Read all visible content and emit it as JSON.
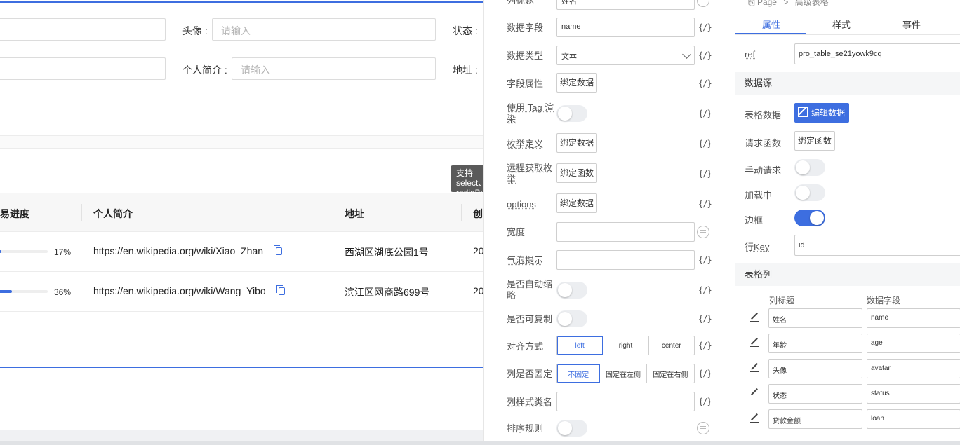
{
  "canvas": {
    "form": {
      "row1": {
        "avatar_label": "头像 :",
        "avatar_placeholder": "请输入",
        "status_label": "状态 :"
      },
      "row2": {
        "intro_label": "个人简介 :",
        "intro_placeholder": "请输入",
        "address_label": "地址 :"
      }
    },
    "tooltip_text": "支持select、radioButton",
    "table": {
      "headers": [
        "易进度",
        "个人简介",
        "地址",
        "创"
      ],
      "rows": [
        {
          "progress": 0.17,
          "progress_label": "17%",
          "intro": "https://en.wikipedia.org/wiki/Xiao_Zhan",
          "address": "西湖区湖底公园1号",
          "created": "20"
        },
        {
          "progress": 0.36,
          "progress_label": "36%",
          "intro": "https://en.wikipedia.org/wiki/Wang_Yibo",
          "address": "滨江区网商路699号",
          "created": "20"
        }
      ]
    }
  },
  "middle": {
    "title_row": {
      "label": "列标题",
      "value": "姓名"
    },
    "field": {
      "label": "数据字段",
      "value": "name"
    },
    "data_type": {
      "label": "数据类型",
      "value": "文本"
    },
    "field_props": {
      "label": "字段属性",
      "button": "绑定数据"
    },
    "use_tag": {
      "label": "使用 Tag 渲染"
    },
    "enum_def": {
      "label": "枚举定义",
      "button": "绑定数据"
    },
    "remote_enum": {
      "label": "远程获取枚举",
      "button": "绑定函数"
    },
    "options": {
      "label": "options",
      "button": "绑定数据"
    },
    "width": {
      "label": "宽度"
    },
    "tooltip": {
      "label": "气泡提示"
    },
    "ellipsis": {
      "label": "是否自动缩略"
    },
    "copyable": {
      "label": "是否可复制"
    },
    "align": {
      "label": "对齐方式",
      "options": [
        "left",
        "right",
        "center"
      ],
      "selected": "left"
    },
    "fixed": {
      "label": "列是否固定",
      "options": [
        "不固定",
        "固定在左侧",
        "固定在右侧"
      ],
      "selected": "不固定"
    },
    "class_name": {
      "label": "列样式类名"
    },
    "sort_rule": {
      "label": "排序规则"
    },
    "brace_icon": "{/}"
  },
  "right": {
    "breadcrumb": {
      "page": "Page",
      "sep": ">",
      "current": "高级表格"
    },
    "tabs": [
      {
        "label": "属性",
        "active": true
      },
      {
        "label": "样式",
        "active": false
      },
      {
        "label": "事件",
        "active": false
      }
    ],
    "ref": {
      "label": "ref",
      "value": "pro_table_se21yowk9cq"
    },
    "datasource_title": "数据源",
    "table_data": {
      "label": "表格数据",
      "button": "编辑数据"
    },
    "request_fn": {
      "label": "请求函数",
      "button": "绑定函数"
    },
    "manual_request": {
      "label": "手动请求",
      "on": false
    },
    "loading": {
      "label": "加载中",
      "on": false
    },
    "bordered": {
      "label": "边框",
      "on": true
    },
    "row_key": {
      "label": "行Key",
      "value": "id"
    },
    "columns_title": "表格列",
    "columns_header": {
      "title": "列标题",
      "field": "数据字段"
    },
    "columns": [
      {
        "title": "姓名",
        "field": "name"
      },
      {
        "title": "年龄",
        "field": "age"
      },
      {
        "title": "头像",
        "field": "avatar"
      },
      {
        "title": "状态",
        "field": "status"
      },
      {
        "title": "贷款金额",
        "field": "loan"
      }
    ]
  },
  "colors": {
    "accent": "#3d6ee0"
  }
}
